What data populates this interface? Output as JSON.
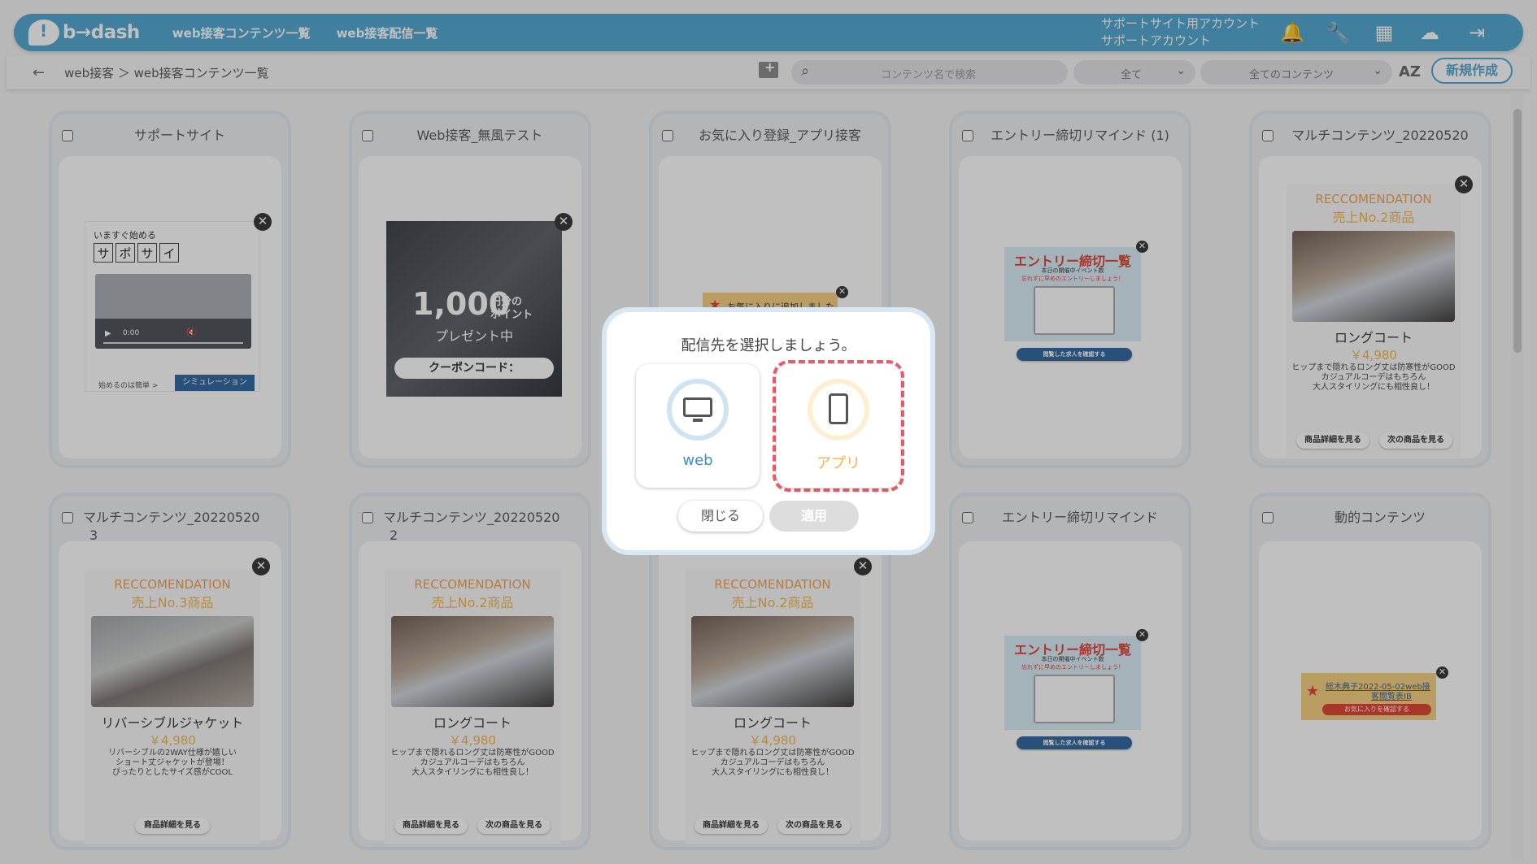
{
  "logo": "b→dash",
  "nav": [
    "web接客コンテンツ一覧",
    "web接客配信一覧"
  ],
  "account": [
    "サポートサイト用アカウント",
    "サポートアカウント"
  ],
  "icons": {
    "bell": "bell-icon",
    "wrench": "wrench-icon",
    "apps": "grid-icon",
    "cloud": "cloud-icon",
    "logout": "logout-icon"
  },
  "breadcrumb": "web接客 ＞ web接客コンテンツ一覧",
  "search": {
    "placeholder": "コンテンツ名で検索"
  },
  "filter1": "全て",
  "filter2": "全てのコンテンツ",
  "sort": "AZ",
  "new_button": "新規作成",
  "cards": [
    {
      "title": "サポートサイト"
    },
    {
      "title": "Web接客_無風テスト"
    },
    {
      "title": "お気に入り登録_アプリ接客"
    },
    {
      "title": "エントリー締切リマインド (1)"
    },
    {
      "title": "マルチコンテンツ_20220520"
    },
    {
      "title": "マルチコンテンツ_20220520\n_3"
    },
    {
      "title": "マルチコンテンツ_20220520\n_2"
    },
    {
      "title": ""
    },
    {
      "title": "エントリー締切リマインド"
    },
    {
      "title": "動的コンテンツ"
    }
  ],
  "support_thumb": {
    "heading": "いますぐ始める",
    "chars": [
      "サ",
      "ポ",
      "サ",
      "イ"
    ],
    "video_time": "0:00",
    "link": "始めるのは簡単 >",
    "button": "シミュレーション"
  },
  "coupon_thumb": {
    "amount": "1,000",
    "unit1": "円分の",
    "unit2": "ポイント",
    "sub": "プレゼント中",
    "code": "クーポンコード："
  },
  "fav_thumb": {
    "text": "お気に入りに追加しました"
  },
  "entry_thumb": {
    "title": "エントリー締切一覧",
    "sub1": "本日の開催中イベント数",
    "sub2": "忘れずに早めのエントリーしましょう！",
    "button": "閲覧した求人を確認する"
  },
  "dynamic_thumb": {
    "text1": "総木典子2022-05-02web接",
    "text2": "客閲覧表IB",
    "button": "お気に入りを確認する"
  },
  "products": [
    {
      "rec": "RECCOMENDATION",
      "rank": "売上No.2商品",
      "name": "ロングコート",
      "price": "￥4,980",
      "desc": [
        "ヒップまで隠れるロング丈は防寒性がGOOD",
        "カジュアルコーデはもちろん",
        "大人スタイリングにも相性良し！"
      ],
      "btn1": "商品詳細を見る",
      "btn2": "次の商品を見る"
    },
    {
      "rec": "RECCOMENDATION",
      "rank": "売上No.3商品",
      "name": "リバーシブルジャケット",
      "price": "￥4,980",
      "desc": [
        "リバーシブルの2WAY仕様が嬉しい",
        "ショート丈ジャケットが登場！",
        "ぴったりとしたサイズ感がCOOL"
      ],
      "btn1": "商品詳細を見る",
      "btn2": ""
    }
  ],
  "modal": {
    "title": "配信先を選択しましょう。",
    "option_web": "web",
    "option_app": "アプリ",
    "close": "閉じる",
    "apply": "適用"
  },
  "colors": {
    "primary": "#4fa6d0",
    "app": "#f3b64a",
    "selected_border": "#ef5b6b"
  }
}
